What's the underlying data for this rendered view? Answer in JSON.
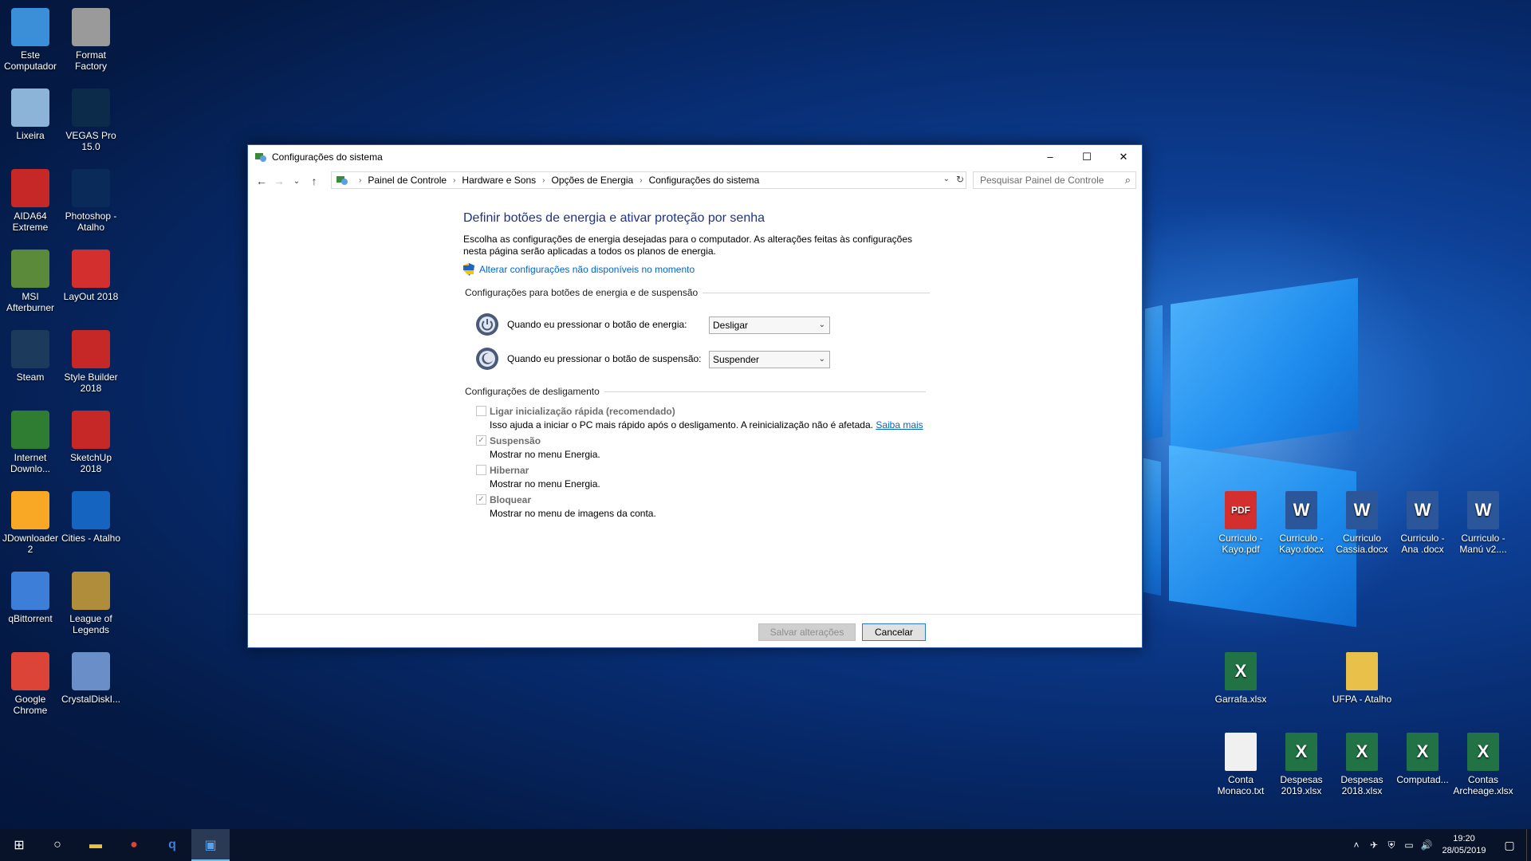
{
  "desktop": {
    "left_icons": [
      {
        "label": "Este Computador",
        "icon": "computer-icon",
        "color": "#3b8fd9"
      },
      {
        "label": "Format Factory",
        "icon": "format-factory-icon",
        "color": "#9a9a9a"
      },
      {
        "label": "Lixeira",
        "icon": "recycle-bin-icon",
        "color": "#8cb4d8"
      },
      {
        "label": "VEGAS Pro 15.0",
        "icon": "vegas-pro-icon",
        "color": "#0c2a4a"
      },
      {
        "label": "AIDA64 Extreme",
        "icon": "aida64-icon",
        "color": "#c62828"
      },
      {
        "label": "Photoshop - Atalho",
        "icon": "photoshop-icon",
        "color": "#0a2a5a"
      },
      {
        "label": "MSI Afterburner",
        "icon": "msi-afterburner-icon",
        "color": "#5a8a3a"
      },
      {
        "label": "LayOut 2018",
        "icon": "layout-icon",
        "color": "#d32f2f"
      },
      {
        "label": "Steam",
        "icon": "steam-icon",
        "color": "#1b3a5c"
      },
      {
        "label": "Style Builder 2018",
        "icon": "style-builder-icon",
        "color": "#c62828"
      },
      {
        "label": "Internet Downlo...",
        "icon": "idm-icon",
        "color": "#2e7d32"
      },
      {
        "label": "SketchUp 2018",
        "icon": "sketchup-icon",
        "color": "#c62828"
      },
      {
        "label": "JDownloader 2",
        "icon": "jdownloader-icon",
        "color": "#f9a825"
      },
      {
        "label": "Cities - Atalho",
        "icon": "cities-icon",
        "color": "#1565c0"
      },
      {
        "label": "qBittorrent",
        "icon": "qbittorrent-icon",
        "color": "#3d7ed8"
      },
      {
        "label": "League of Legends",
        "icon": "league-of-legends-icon",
        "color": "#b08d3a"
      },
      {
        "label": "Google Chrome",
        "icon": "chrome-icon",
        "color": "#db4437"
      },
      {
        "label": "CrystalDiskI...",
        "icon": "crystaldisk-icon",
        "color": "#6a8fc8"
      }
    ],
    "right_icons": [
      {
        "label": "Curriculo - Kayo.pdf",
        "icon": "pdf-icon",
        "color": "#d32f2f",
        "glyph": "PDF"
      },
      {
        "label": "Curriculo - Kayo.docx",
        "icon": "word-icon",
        "color": "#2b579a",
        "glyph": "W"
      },
      {
        "label": "Curriculo Cassia.docx",
        "icon": "word-icon",
        "color": "#2b579a",
        "glyph": "W"
      },
      {
        "label": "Curriculo - Ana .docx",
        "icon": "word-icon",
        "color": "#2b579a",
        "glyph": "W"
      },
      {
        "label": "Curriculo - Manú v2....",
        "icon": "word-icon",
        "color": "#2b579a",
        "glyph": "W"
      },
      {
        "label": "Garrafa.xlsx",
        "icon": "excel-icon",
        "color": "#217346",
        "glyph": "X"
      },
      {
        "label": "UFPA - Atalho",
        "icon": "folder-icon",
        "color": "#e8c04a",
        "glyph": ""
      },
      {
        "label": "Conta Monaco.txt",
        "icon": "text-file-icon",
        "color": "#f0f0f0",
        "glyph": ""
      },
      {
        "label": "Despesas 2019.xlsx",
        "icon": "excel-icon",
        "color": "#217346",
        "glyph": "X"
      },
      {
        "label": "Despesas 2018.xlsx",
        "icon": "excel-icon",
        "color": "#217346",
        "glyph": "X"
      },
      {
        "label": "Computad...",
        "icon": "excel-icon",
        "color": "#217346",
        "glyph": "X"
      },
      {
        "label": "Contas Archeage.xlsx",
        "icon": "excel-icon",
        "color": "#217346",
        "glyph": "X"
      }
    ]
  },
  "window": {
    "title": "Configurações do sistema",
    "controls": {
      "minimize": "–",
      "maximize": "☐",
      "close": "✕"
    },
    "nav": {
      "back": "←",
      "forward": "→",
      "recent": "⌄",
      "up": "↑"
    },
    "breadcrumb": [
      "Painel de Controle",
      "Hardware e Sons",
      "Opções de Energia",
      "Configurações do sistema"
    ],
    "breadcrumb_sep": "›",
    "address_dropdown": "⌄",
    "refresh": "↻",
    "search_placeholder": "Pesquisar Painel de Controle",
    "search_icon": "⌕",
    "heading": "Definir botões de energia e ativar proteção por senha",
    "description": "Escolha as configurações de energia desejadas para o computador. As alterações feitas às configurações nesta página serão aplicadas a todos os planos de energia.",
    "admin_link": "Alterar configurações não disponíveis no momento",
    "group_buttons_title": "Configurações para botões de energia e de suspensão",
    "power_button_label": "Quando eu pressionar o botão de energia:",
    "power_button_value": "Desligar",
    "sleep_button_label": "Quando eu pressionar o botão de suspensão:",
    "sleep_button_value": "Suspender",
    "group_shutdown_title": "Configurações de desligamento",
    "options": [
      {
        "label": "Ligar inicialização rápida (recomendado)",
        "checked": false,
        "sub": "Isso ajuda a iniciar o PC mais rápido após o desligamento. A reinicialização não é afetada.",
        "link": "Saiba mais"
      },
      {
        "label": "Suspensão",
        "checked": true,
        "sub": "Mostrar no menu Energia.",
        "link": ""
      },
      {
        "label": "Hibernar",
        "checked": false,
        "sub": "Mostrar no menu Energia.",
        "link": ""
      },
      {
        "label": "Bloquear",
        "checked": true,
        "sub": "Mostrar no menu de imagens da conta.",
        "link": ""
      }
    ],
    "check_mark": "✓",
    "save_button": "Salvar alterações",
    "cancel_button": "Cancelar",
    "accent": "#1e3287",
    "link_color": "#0066cc"
  },
  "taskbar": {
    "start": "⊞",
    "search": "○",
    "apps": [
      {
        "name": "file-explorer",
        "glyph": "▬",
        "color": "#f0c040",
        "active": false
      },
      {
        "name": "chrome",
        "glyph": "●",
        "color": "#db4437",
        "active": false
      },
      {
        "name": "qbittorrent",
        "glyph": "q",
        "color": "#3d7ed8",
        "active": false
      },
      {
        "name": "control-panel",
        "glyph": "▣",
        "color": "#5aa0e8",
        "active": true
      }
    ],
    "tray_icons": [
      "˄",
      "✈",
      "⛨",
      "▭",
      "🔊"
    ],
    "time": "19:20",
    "date": "28/05/2019",
    "notifications": "▢"
  }
}
